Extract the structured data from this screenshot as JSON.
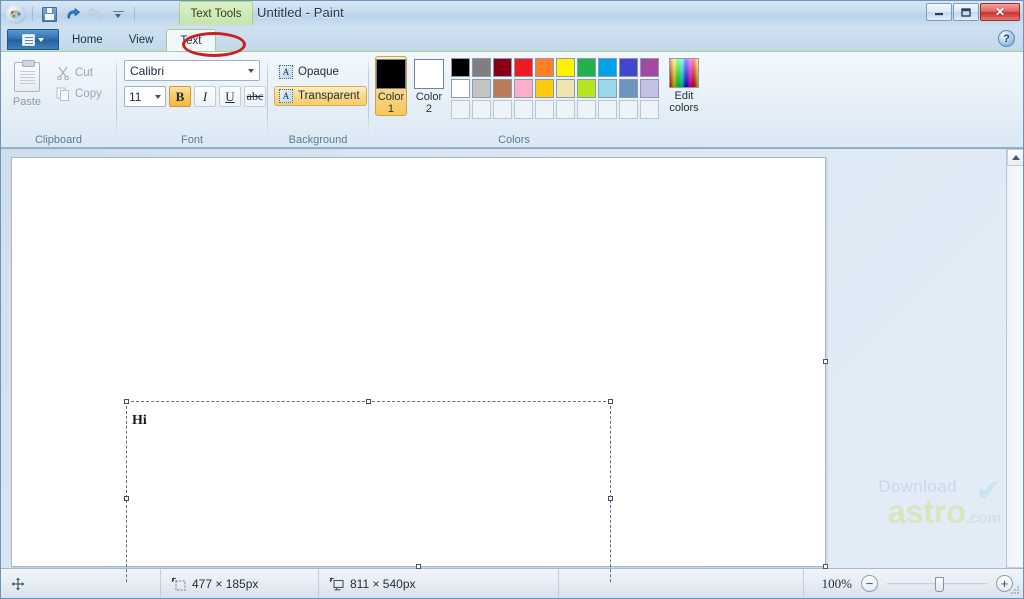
{
  "window": {
    "title": "Untitled - Paint",
    "contextual_tab_group": "Text Tools",
    "buttons": {
      "minimize": "—",
      "maximize": "❐",
      "close": "✕"
    }
  },
  "quick_access": {
    "items": [
      {
        "name": "paint-orb-icon",
        "label": "Paint"
      },
      {
        "name": "save-icon",
        "label": "Save"
      },
      {
        "name": "undo-icon",
        "label": "Undo"
      },
      {
        "name": "redo-icon",
        "label": "Redo"
      },
      {
        "name": "customize-qat-icon",
        "label": "Customize Quick Access Toolbar"
      }
    ]
  },
  "tabs": {
    "app_button": "Paint menu",
    "items": [
      {
        "label": "Home",
        "active": false
      },
      {
        "label": "View",
        "active": false
      },
      {
        "label": "Text",
        "active": true
      }
    ],
    "help": "?"
  },
  "ribbon": {
    "groups": [
      {
        "name": "Clipboard",
        "paste_label": "Paste",
        "cut_label": "Cut",
        "copy_label": "Copy"
      },
      {
        "name": "Font",
        "font_family": "Calibri",
        "font_size": "11",
        "bold": "B",
        "italic": "I",
        "underline": "U",
        "strikethrough": "abc",
        "bold_active": true
      },
      {
        "name": "Background",
        "opaque_label": "Opaque",
        "transparent_label": "Transparent",
        "selected": "Transparent"
      },
      {
        "name": "Colors",
        "color1_label_line1": "Color",
        "color1_label_line2": "1",
        "color1_value": "#000000",
        "color2_label_line1": "Color",
        "color2_label_line2": "2",
        "color2_value": "#ffffff",
        "edit_colors_line1": "Edit",
        "edit_colors_line2": "colors",
        "palette_row1": [
          "#000000",
          "#7f7f7f",
          "#880015",
          "#ed1c24",
          "#ff7f27",
          "#fff200",
          "#22b14c",
          "#00a2e8",
          "#3f48cc",
          "#a349a4"
        ],
        "palette_row2": [
          "#ffffff",
          "#c3c3c3",
          "#b97a57",
          "#ffaec9",
          "#ffc90e",
          "#efe4b0",
          "#b5e61d",
          "#99d9ea",
          "#7092be",
          "#c8bfe7"
        ],
        "palette_row3": [
          "",
          "",
          "",
          "",
          "",
          "",
          "",
          "",
          "",
          ""
        ]
      }
    ]
  },
  "canvas": {
    "textbox_content": "Hi"
  },
  "statusbar": {
    "cursor_icon": "move-icon",
    "selection_size": "477 × 185px",
    "canvas_size": "811 × 540px",
    "zoom_level": "100%",
    "zoom_out": "−",
    "zoom_in": "+"
  },
  "watermark": {
    "line1": "Download",
    "line2": "astro",
    "line3": ".com"
  },
  "annotation": {
    "type": "red-ellipse",
    "target": "Text tab",
    "color": "#cc1f1f"
  }
}
